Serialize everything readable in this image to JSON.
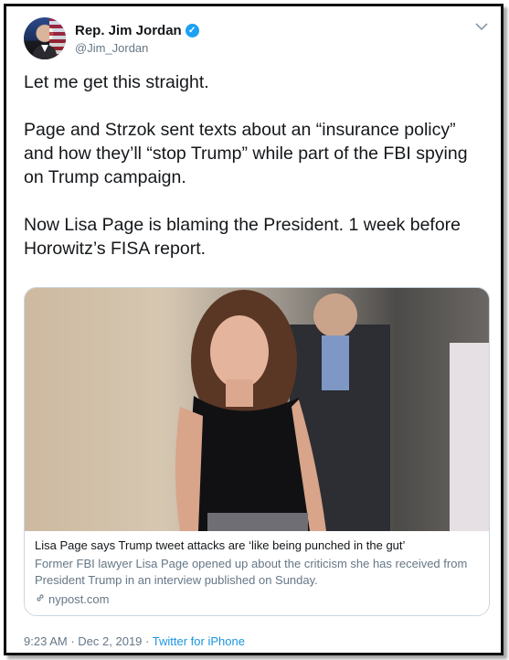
{
  "author": {
    "display_name": "Rep. Jim Jordan",
    "handle": "@Jim_Jordan",
    "verified_icon": "verified-badge-icon"
  },
  "menu_icon": "chevron-down-icon",
  "tweet": {
    "paragraphs": [
      "Let me get this straight.",
      "Page and Strzok sent texts about an “insurance policy” and how they’ll “stop Trump” while part of the FBI spying on Trump campaign.",
      "Now Lisa Page is blaming the President. 1 week before Horowitz’s FISA report."
    ]
  },
  "card": {
    "title": "Lisa Page says Trump tweet attacks are ‘like being punched in the gut’",
    "description": "Former FBI lawyer Lisa Page opened up about the criticism she has received from President Trump in an interview published on Sunday.",
    "domain": "nypost.com",
    "link_icon": "link-icon"
  },
  "meta": {
    "time": "9:23 AM",
    "separator": "·",
    "date": "Dec 2, 2019",
    "source": "Twitter for iPhone"
  },
  "colors": {
    "accent": "#1da1f2",
    "secondary_text": "#657786",
    "border": "#ccd6dd"
  }
}
